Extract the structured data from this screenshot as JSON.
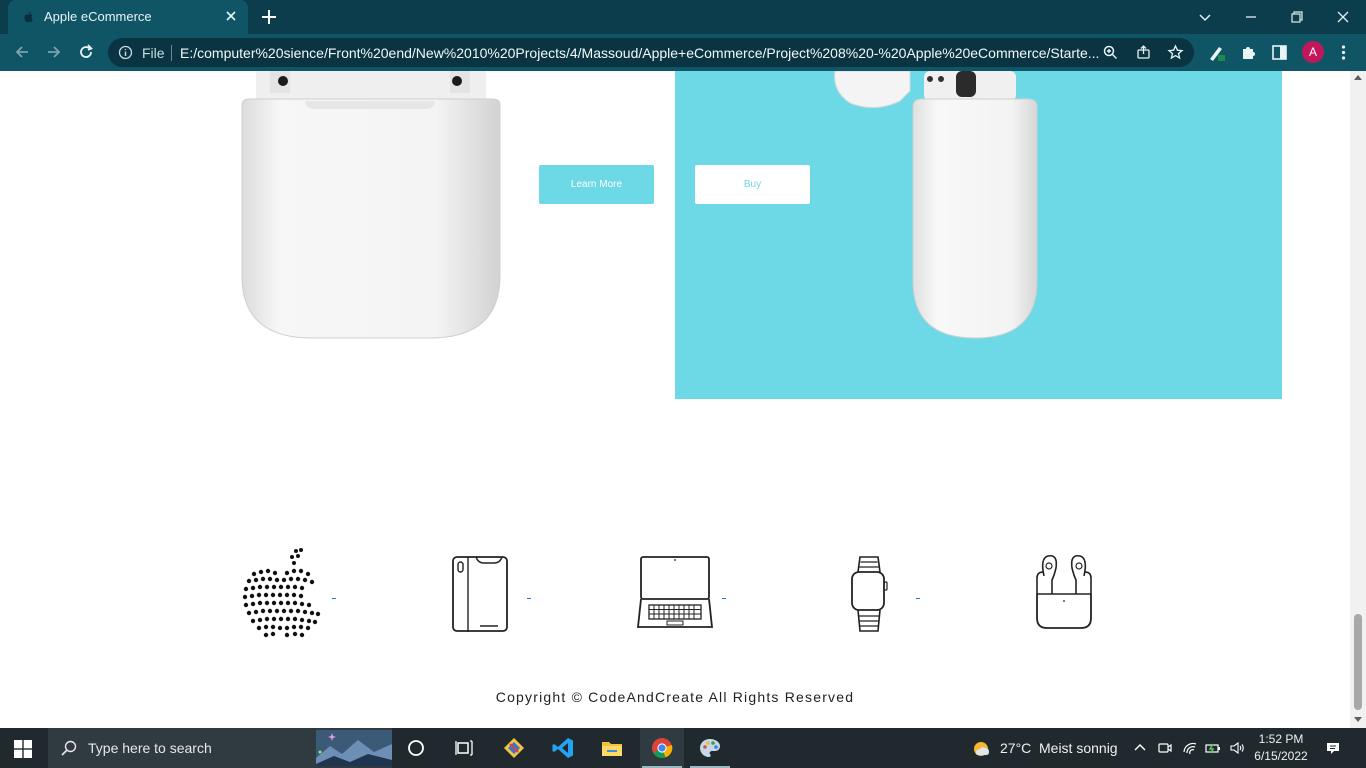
{
  "browser": {
    "tab_title": "Apple eCommerce",
    "omnibox_scheme": "File",
    "url": "E:/computer%20sience/Front%20end/New%2010%20Projects/4/Massoud/Apple+eCommerce/Project%208%20-%20Apple%20eCommerce/Starte...",
    "profile_initial": "A"
  },
  "page": {
    "learn_more_label": "Learn More",
    "buy_label": "Buy",
    "copyright": "Copyright © CodeAndCreate All Rights Reserved",
    "accent_color": "#6ed9e6"
  },
  "footer_icons": [
    "apple-logo-icon",
    "iphone-icon",
    "macbook-icon",
    "apple-watch-icon",
    "airpods-icon"
  ],
  "taskbar": {
    "search_placeholder": "Type here to search",
    "weather_temp": "27°C",
    "weather_desc": "Meist sonnig",
    "time": "1:52 PM",
    "date": "6/15/2022"
  }
}
